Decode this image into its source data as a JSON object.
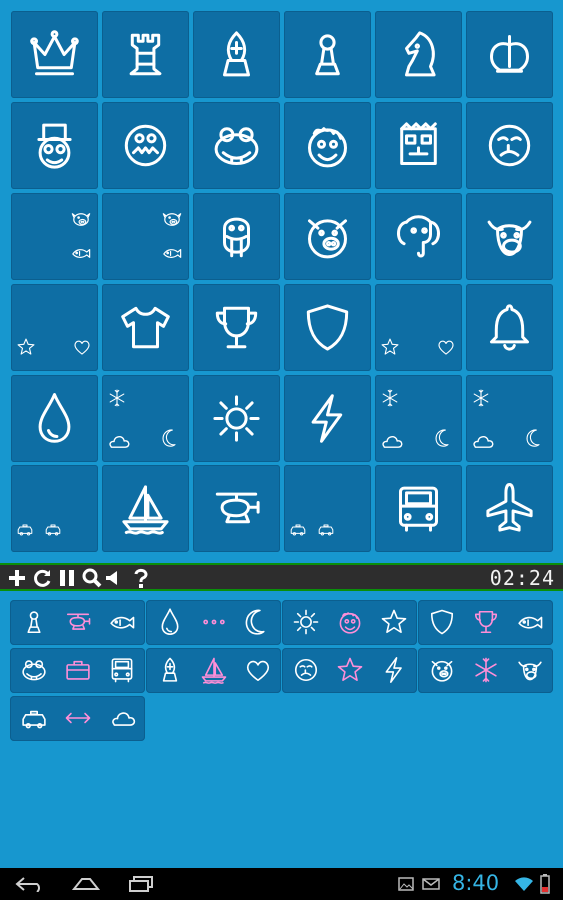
{
  "toolbar": {
    "timer": "02:24",
    "buttons": [
      "add-icon",
      "refresh-icon",
      "pause-icon",
      "zoom-icon",
      "volume-icon",
      "help-icon"
    ]
  },
  "board": {
    "rows": [
      [
        [
          "queen"
        ],
        [
          "rook"
        ],
        [
          "bishop"
        ],
        [
          "pawn"
        ],
        [
          "knight"
        ],
        [
          "king"
        ]
      ],
      [
        [
          "hat-face"
        ],
        [
          "grin-face"
        ],
        [
          "frog"
        ],
        [
          "curly-face"
        ],
        [
          "box-face"
        ],
        [
          "sad-face"
        ]
      ],
      [
        [
          "cow",
          "fish"
        ],
        [
          "cow",
          "fish"
        ],
        [
          "walrus"
        ],
        [
          "pig"
        ],
        [
          "elephant"
        ],
        [
          "bull"
        ]
      ],
      [
        [
          "star",
          "heart"
        ],
        [
          "shirt"
        ],
        [
          "trophy"
        ],
        [
          "shield"
        ],
        [
          "star",
          "heart"
        ],
        [
          "bell"
        ]
      ],
      [
        [
          "drop"
        ],
        [
          "snowflake",
          "cloud",
          "moon"
        ],
        [
          "sun"
        ],
        [
          "bolt"
        ],
        [
          "snowflake",
          "cloud",
          "moon"
        ],
        [
          "snowflake",
          "cloud",
          "moon"
        ]
      ],
      [
        [
          "taxi",
          "taxi"
        ],
        [
          "sailboat"
        ],
        [
          "helicopter"
        ],
        [
          "taxi",
          "taxi"
        ],
        [
          "bus"
        ],
        [
          "airplane"
        ]
      ]
    ]
  },
  "groups": [
    [
      "pawn",
      "helicopter",
      "fish"
    ],
    [
      "drop",
      "dots",
      "moon"
    ],
    [
      "sun",
      "curly-face",
      "star"
    ],
    [
      "shield",
      "trophy",
      "fish"
    ],
    [
      "frog",
      "suitcase",
      "bus"
    ],
    [
      "bishop",
      "sailboat",
      "heart"
    ],
    [
      "sad-face",
      "star",
      "bolt"
    ],
    [
      "pig",
      "snowflake",
      "bull"
    ],
    [
      "taxi",
      "arrow",
      "cloud"
    ]
  ],
  "group_pink": [
    [
      false,
      true,
      false
    ],
    [
      false,
      true,
      false
    ],
    [
      false,
      true,
      false
    ],
    [
      false,
      true,
      false
    ],
    [
      false,
      true,
      false
    ],
    [
      false,
      true,
      false
    ],
    [
      false,
      true,
      false
    ],
    [
      false,
      true,
      false
    ],
    [
      false,
      true,
      false
    ]
  ],
  "status": {
    "clock": "8:40"
  },
  "colors": {
    "background": "#1797cf",
    "tile": "#0e6ea4",
    "icon": "#ffffff",
    "pink": "#ff8fd8",
    "toolbar_line": "#0a8f0a",
    "clock": "#35b5e5"
  }
}
